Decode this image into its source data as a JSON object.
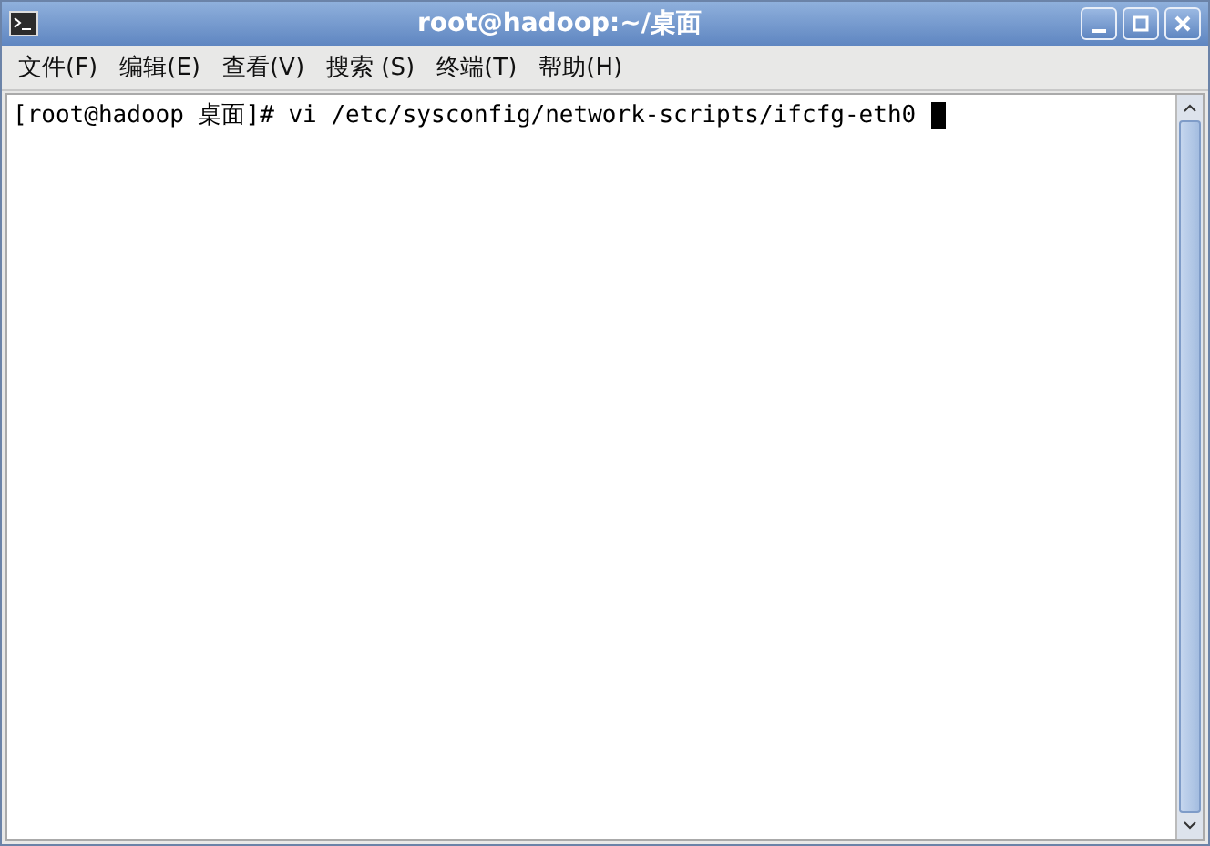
{
  "window": {
    "title": "root@hadoop:~/桌面"
  },
  "menu": [
    "文件(F)",
    "编辑(E)",
    "查看(V)",
    "搜索 (S)",
    "终端(T)",
    "帮助(H)"
  ],
  "terminal": {
    "lines": [
      "[root@hadoop 桌面]# vi /etc/sysconfig/network-scripts/ifcfg-eth0"
    ],
    "cursor": true
  }
}
